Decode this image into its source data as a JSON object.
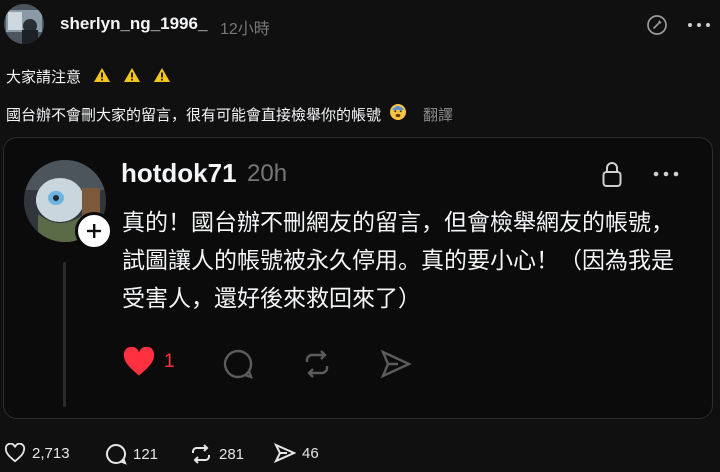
{
  "post": {
    "username": "sherlyn_ng_1996_",
    "timestamp": "12小時",
    "line1": "大家請注意",
    "line2": "國台辦不會刪大家的留言，很有可能會直接檢舉你的帳號",
    "translate_label": "翻譯"
  },
  "quoted": {
    "username": "hotdok71",
    "timestamp": "20h",
    "text": "真的！國台辦不刪網友的留言，但會檢舉網友的帳號，試圖讓人的帳號被永久停用。真的要小心！（因為我是受害人，還好後來救回來了）",
    "like_count": "1"
  },
  "actions": {
    "likes": "2,713",
    "comments": "121",
    "reposts": "281",
    "shares": "46"
  },
  "colors": {
    "accent_like": "#ff3040",
    "warning": "#f5c518"
  },
  "icons": [
    "verified-edit-icon",
    "more-icon",
    "lock-icon",
    "plus-icon",
    "heart-icon",
    "comment-icon",
    "repost-icon",
    "share-icon",
    "warning-icon",
    "anxious-face-emoji"
  ]
}
